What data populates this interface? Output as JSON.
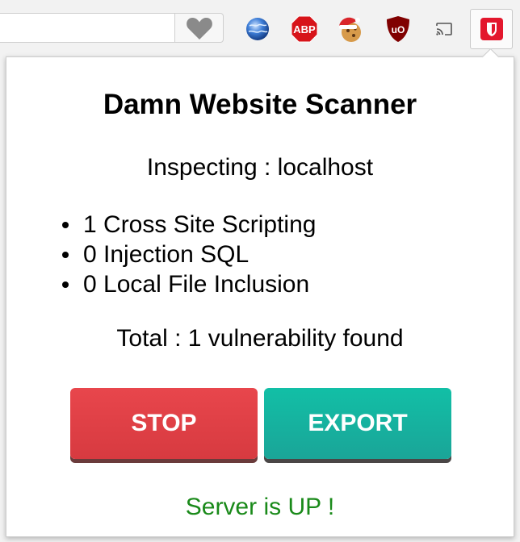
{
  "toolbar": {
    "extensions": [
      {
        "icon": "globe-icon"
      },
      {
        "icon": "adblock-plus-icon",
        "label": "ABP"
      },
      {
        "icon": "cookie-icon"
      },
      {
        "icon": "ublock-origin-icon",
        "label": "uO"
      },
      {
        "icon": "cast-icon"
      },
      {
        "icon": "damn-scanner-shield-icon"
      }
    ],
    "bookmark_icon": "heart-icon"
  },
  "popup": {
    "title": "Damn Website Scanner",
    "inspecting_label": "Inspecting : ",
    "inspecting_host": "localhost",
    "vulnerabilities": [
      {
        "count": "1",
        "name": "Cross Site Scripting"
      },
      {
        "count": "0",
        "name": "Injection SQL"
      },
      {
        "count": "0",
        "name": "Local File Inclusion"
      }
    ],
    "total_label": "Total : ",
    "total_count": "1",
    "total_suffix": " vulnerability found",
    "stop_label": "STOP",
    "export_label": "EXPORT",
    "status_text": "Server is UP !"
  },
  "colors": {
    "stop": "#e0434a",
    "export": "#14b5a0",
    "status": "#1a8a1a"
  }
}
